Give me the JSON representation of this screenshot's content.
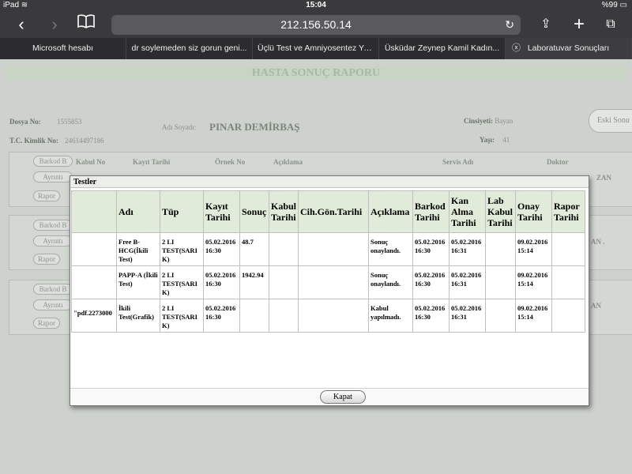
{
  "statusbar": {
    "device": "iPad",
    "wifi": "wifi",
    "time": "15:04",
    "battery": "%99"
  },
  "browser": {
    "url": "212.156.50.14",
    "tabs": [
      {
        "label": "Microsoft hesabı"
      },
      {
        "label": "dr soylemeden siz gorun geni..."
      },
      {
        "label": "Üçlü Test ve Amniyosentez Ya..."
      },
      {
        "label": "Üsküdar Zeynep Kamil Kadın..."
      },
      {
        "label": "Laboratuvar Sonuçları"
      }
    ]
  },
  "report": {
    "title": "HASTA SONUÇ RAPORU",
    "dosya_label": "Dosya No:",
    "dosya_value": "1555853",
    "tc_label": "T.C. Kimlik No:",
    "tc_value": "24614497186",
    "adsoyad_label": "Adı Soyadı:",
    "adsoyad_value": "PINAR DEMİRBAŞ",
    "cinsiyet_label": "Cinsiyeti:",
    "cinsiyet_value": "Bayan",
    "yas_label": "Yaşı:",
    "yas_value": "41",
    "eski_button": "Eski Sonu",
    "bg_headers": [
      "Kabul No",
      "Kayıt Tarihi",
      "Örnek No",
      "Açıklama",
      "Servis Adı",
      "Doktor"
    ],
    "barkod_btn": "Barkod B",
    "ayrinti_btn": "Ayrıntı",
    "rapor_btn": "Rapor",
    "bg_cut_texts": [
      "ZAN",
      "AN .",
      "AN"
    ]
  },
  "modal": {
    "title": "Testler",
    "columns": [
      "",
      "Adı",
      "Tüp",
      "Kayıt Tarihi",
      "Sonuç",
      "Kabul Tarihi",
      "Cih.Gön.Tarihi",
      "Açıklama",
      "Barkod Tarihi",
      "Kan Alma Tarihi",
      "Lab Kabul Tarihi",
      "Onay Tarihi",
      "Rapor Tarihi"
    ],
    "rows": [
      {
        "c0": "",
        "adi": "Free B-HCG(İkili Test)",
        "tup": "2 LI TEST(SARI K)",
        "kayit": "05.02.2016 16:30",
        "sonuc": "48.7",
        "kabul": "",
        "cih": "",
        "aciklama": "Sonuç onaylandı.",
        "barkod": "05.02.2016 16:30",
        "kan": "05.02.2016 16:31",
        "lab": "",
        "onay": "09.02.2016 15:14",
        "rapor": ""
      },
      {
        "c0": "",
        "adi": "PAPP-A (İkili Test)",
        "tup": "2 LI TEST(SARI K)",
        "kayit": "05.02.2016 16:30",
        "sonuc": "1942.94",
        "kabul": "",
        "cih": "",
        "aciklama": "Sonuç onaylandı.",
        "barkod": "05.02.2016 16:30",
        "kan": "05.02.2016 16:31",
        "lab": "",
        "onay": "09.02.2016 15:14",
        "rapor": ""
      },
      {
        "c0": "2273000.pdf\"",
        "adi": "İkili Test(Grafik)",
        "tup": "2 LI TEST(SARI K)",
        "kayit": "05.02.2016 16:30",
        "sonuc": "",
        "kabul": "",
        "cih": "",
        "aciklama": "Kabul yapılmadı.",
        "barkod": "05.02.2016 16:30",
        "kan": "05.02.2016 16:31",
        "lab": "",
        "onay": "09.02.2016 15:14",
        "rapor": ""
      }
    ],
    "close_button": "Kapat"
  }
}
